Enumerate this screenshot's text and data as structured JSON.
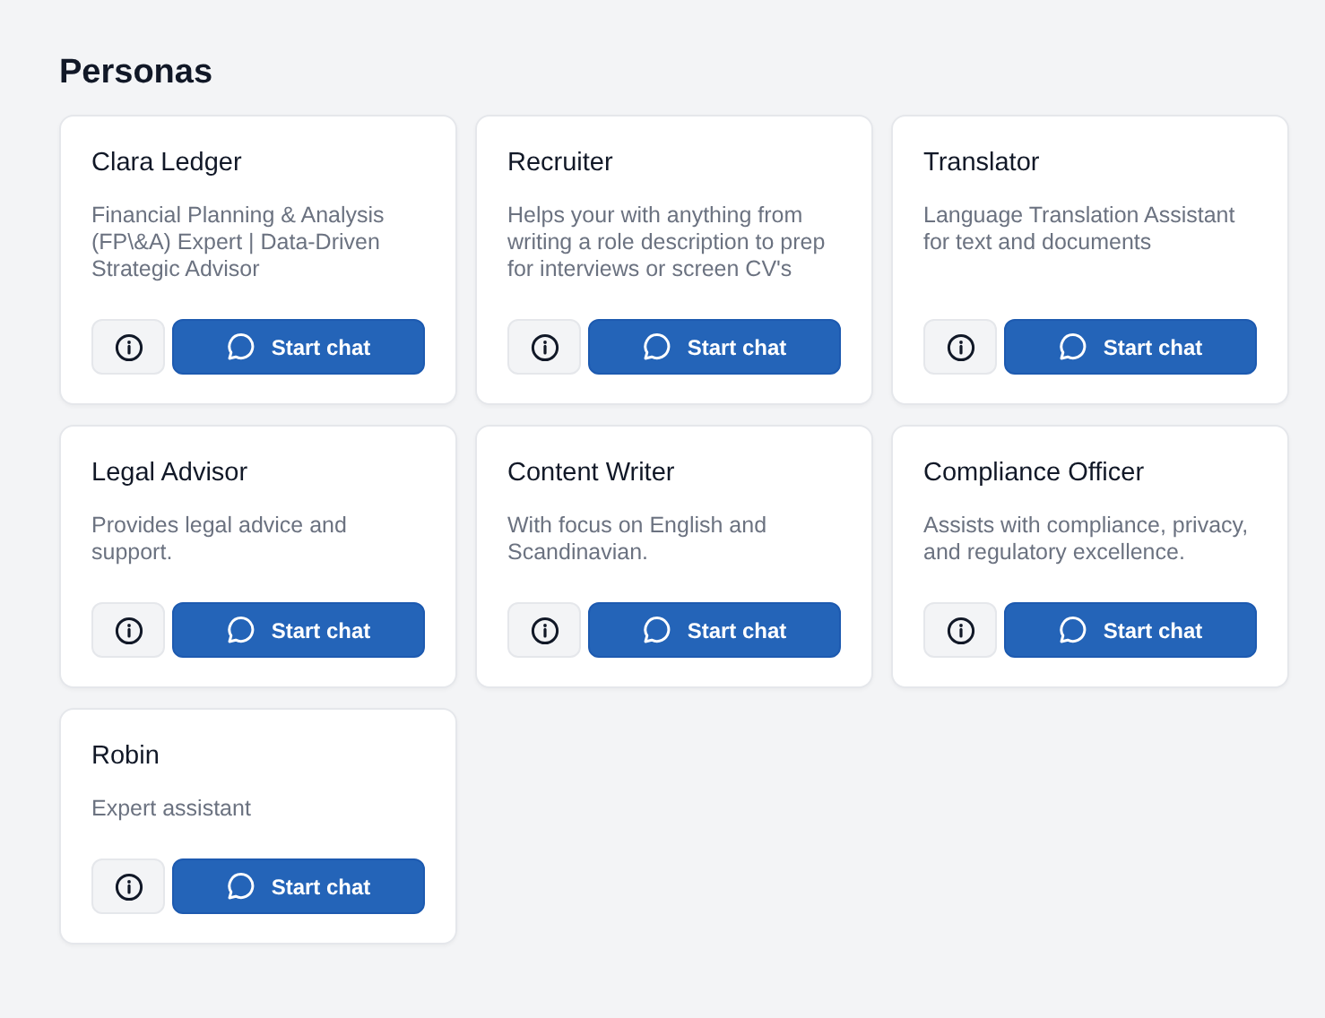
{
  "heading": "Personas",
  "personas": [
    {
      "name": "Clara Ledger",
      "description": "Financial Planning & Analysis (FP\\&A) Expert | Data-Driven Strategic Advisor",
      "action": "Start chat"
    },
    {
      "name": "Recruiter",
      "description": "Helps your with anything from writing a role description to prep for interviews or screen CV's",
      "action": "Start chat"
    },
    {
      "name": "Translator",
      "description": "Language Translation Assistant for text and documents",
      "action": "Start chat"
    },
    {
      "name": "Legal Advisor",
      "description": "Provides legal advice and support.",
      "action": "Start chat"
    },
    {
      "name": "Content Writer",
      "description": "With focus on English and Scandinavian.",
      "action": "Start chat"
    },
    {
      "name": "Compliance Officer",
      "description": "Assists with compliance, privacy, and regulatory excellence.",
      "action": "Start chat"
    },
    {
      "name": "Robin",
      "description": "Expert assistant",
      "action": "Start chat"
    }
  ]
}
